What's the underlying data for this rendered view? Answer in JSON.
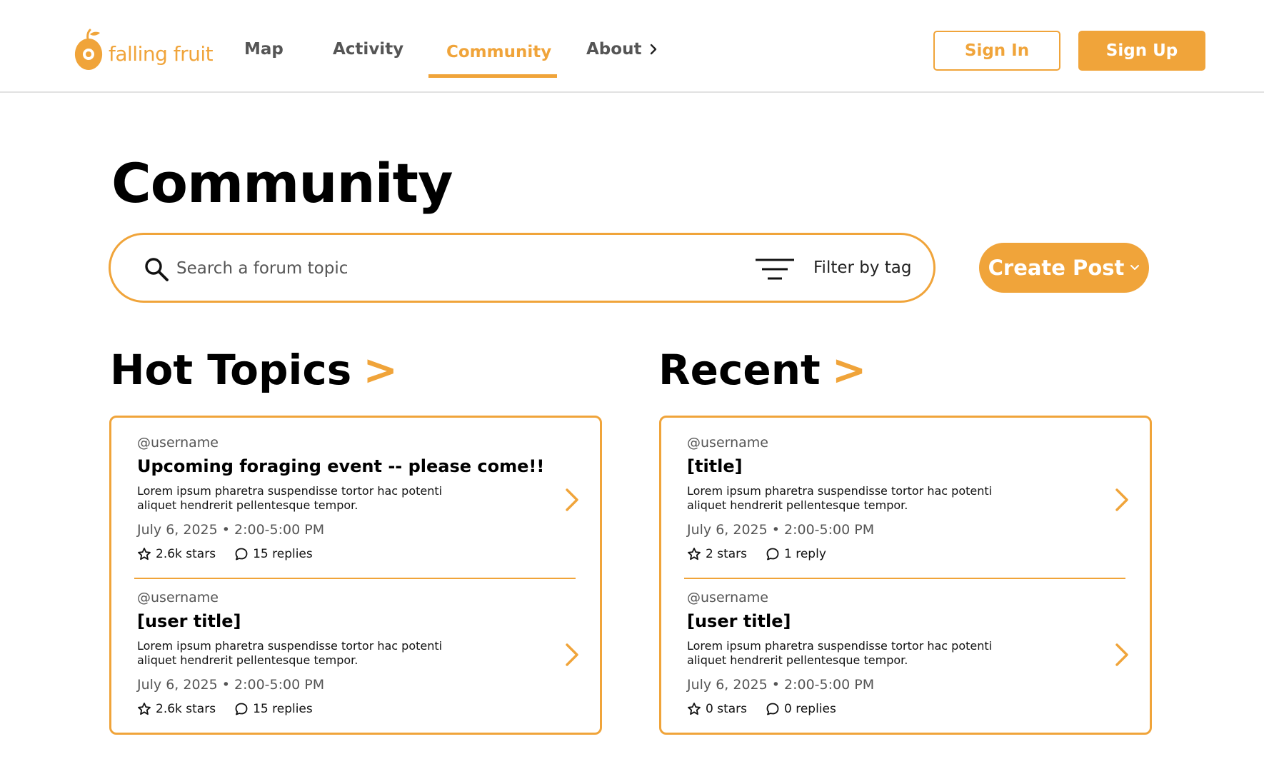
{
  "brand": {
    "name": "falling fruit",
    "accent": "#f0a43a"
  },
  "nav": {
    "items": [
      {
        "label": "Map"
      },
      {
        "label": "Activity"
      },
      {
        "label": "Community"
      },
      {
        "label": "About"
      }
    ],
    "active": "Community"
  },
  "auth": {
    "sign_in": "Sign In",
    "sign_up": "Sign Up"
  },
  "page": {
    "title": "Community"
  },
  "search": {
    "placeholder": "Search a forum topic",
    "filter_label": "Filter by tag"
  },
  "create_post": {
    "label": "Create Post"
  },
  "sections": {
    "hot": {
      "title": "Hot Topics",
      "arrow": ">",
      "posts": [
        {
          "username": "@username",
          "title": "Upcoming foraging event -- please come!!",
          "body": "Lorem ipsum pharetra suspendisse tortor hac potenti aliquet hendrerit pellentesque tempor.",
          "date": "July 6, 2025 • 2:00-5:00 PM",
          "stars": "2.6k stars",
          "replies": "15 replies"
        },
        {
          "username": "@username",
          "title": "[user title]",
          "body": "Lorem ipsum pharetra suspendisse tortor hac potenti aliquet hendrerit pellentesque tempor.",
          "date": "July 6, 2025 • 2:00-5:00 PM",
          "stars": "2.6k stars",
          "replies": "15 replies"
        }
      ]
    },
    "recent": {
      "title": "Recent",
      "arrow": ">",
      "posts": [
        {
          "username": "@username",
          "title": "[title]",
          "body": "Lorem ipsum pharetra suspendisse tortor hac potenti aliquet hendrerit pellentesque tempor.",
          "date": "July 6, 2025 • 2:00-5:00 PM",
          "stars": "2 stars",
          "replies": "1 reply"
        },
        {
          "username": "@username",
          "title": "[user title]",
          "body": "Lorem ipsum pharetra suspendisse tortor hac potenti aliquet hendrerit pellentesque tempor.",
          "date": "July 6, 2025 • 2:00-5:00 PM",
          "stars": "0 stars",
          "replies": "0 replies"
        }
      ]
    }
  },
  "icons": {
    "logo": "pear-pin-icon",
    "search": "search-icon",
    "filter": "filter-icon",
    "star": "star-outline-icon",
    "reply": "speech-bubble-icon",
    "chevron_right": "chevron-right-icon",
    "chevron_down": "chevron-down-icon"
  }
}
